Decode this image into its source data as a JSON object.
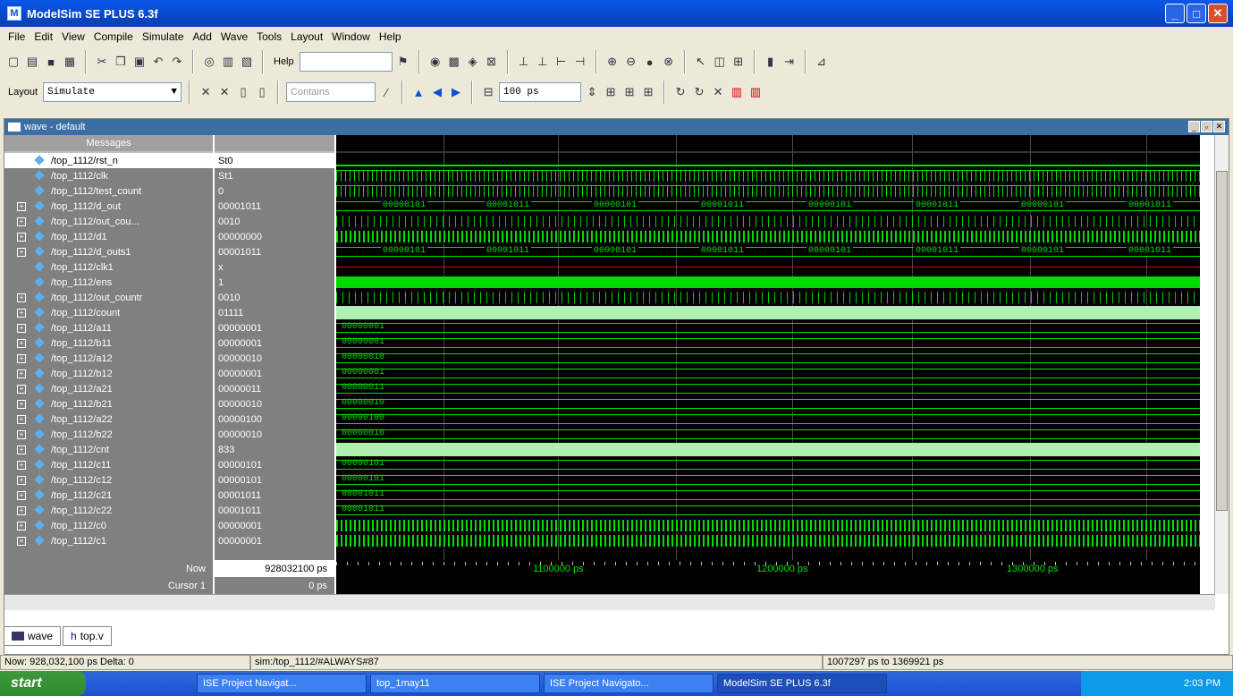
{
  "window": {
    "title": "ModelSim SE PLUS 6.3f"
  },
  "menu": [
    "File",
    "Edit",
    "View",
    "Compile",
    "Simulate",
    "Add",
    "Wave",
    "Tools",
    "Layout",
    "Window",
    "Help"
  ],
  "toolbar": {
    "help_label": "Help",
    "layout_label": "Layout",
    "layout_value": "Simulate",
    "contains_placeholder": "Contains",
    "run_length": "100 ps"
  },
  "wave": {
    "panel_title": "wave - default",
    "messages_header": "Messages",
    "signals": [
      {
        "name": "/top_1112/rst_n",
        "value": "St0",
        "expand": false
      },
      {
        "name": "/top_1112/clk",
        "value": "St1",
        "expand": false
      },
      {
        "name": "/top_1112/test_count",
        "value": "0",
        "expand": false
      },
      {
        "name": "/top_1112/d_out",
        "value": "00001011",
        "expand": true
      },
      {
        "name": "/top_1112/out_cou...",
        "value": "0010",
        "expand": true
      },
      {
        "name": "/top_1112/d1",
        "value": "00000000",
        "expand": true
      },
      {
        "name": "/top_1112/d_outs1",
        "value": "00001011",
        "expand": true
      },
      {
        "name": "/top_1112/clk1",
        "value": "x",
        "expand": false
      },
      {
        "name": "/top_1112/ens",
        "value": "1",
        "expand": false
      },
      {
        "name": "/top_1112/out_countr",
        "value": "0010",
        "expand": true
      },
      {
        "name": "/top_1112/count",
        "value": "01111",
        "expand": true
      },
      {
        "name": "/top_1112/a11",
        "value": "00000001",
        "expand": true
      },
      {
        "name": "/top_1112/b11",
        "value": "00000001",
        "expand": true
      },
      {
        "name": "/top_1112/a12",
        "value": "00000010",
        "expand": true
      },
      {
        "name": "/top_1112/b12",
        "value": "00000001",
        "expand": true
      },
      {
        "name": "/top_1112/a21",
        "value": "00000011",
        "expand": true
      },
      {
        "name": "/top_1112/b21",
        "value": "00000010",
        "expand": true
      },
      {
        "name": "/top_1112/a22",
        "value": "00000100",
        "expand": true
      },
      {
        "name": "/top_1112/b22",
        "value": "00000010",
        "expand": true
      },
      {
        "name": "/top_1112/cnt",
        "value": "833",
        "expand": true
      },
      {
        "name": "/top_1112/c11",
        "value": "00000101",
        "expand": true
      },
      {
        "name": "/top_1112/c12",
        "value": "00000101",
        "expand": true
      },
      {
        "name": "/top_1112/c21",
        "value": "00001011",
        "expand": true
      },
      {
        "name": "/top_1112/c22",
        "value": "00001011",
        "expand": true
      },
      {
        "name": "/top_1112/c0",
        "value": "00000001",
        "expand": true
      },
      {
        "name": "/top_1112/c1",
        "value": "00000001",
        "expand": true
      }
    ],
    "d_out_labels": [
      "00000101",
      "00001011",
      "00000101",
      "00001011",
      "00000101",
      "00001011",
      "00000101",
      "00001011"
    ],
    "now_label": "Now",
    "now_value": "928032100 ps",
    "cursor_label": "Cursor 1",
    "cursor_value": "0 ps",
    "time_labels": [
      "1100000 ps",
      "1200000 ps",
      "1300000 ps"
    ]
  },
  "tabs": [
    "wave",
    "top.v"
  ],
  "status": {
    "now": "Now: 928,032,100 ps  Delta: 0",
    "path": "sim:/top_1112/#ALWAYS#87",
    "range": "1007297 ps to 1369921 ps"
  },
  "taskbar": {
    "start": "start",
    "tasks": [
      "ISE Project Navigat...",
      "top_1may11",
      "ISE Project Navigato...",
      "ModelSim SE PLUS 6.3f"
    ],
    "clock": "2:03 PM"
  }
}
